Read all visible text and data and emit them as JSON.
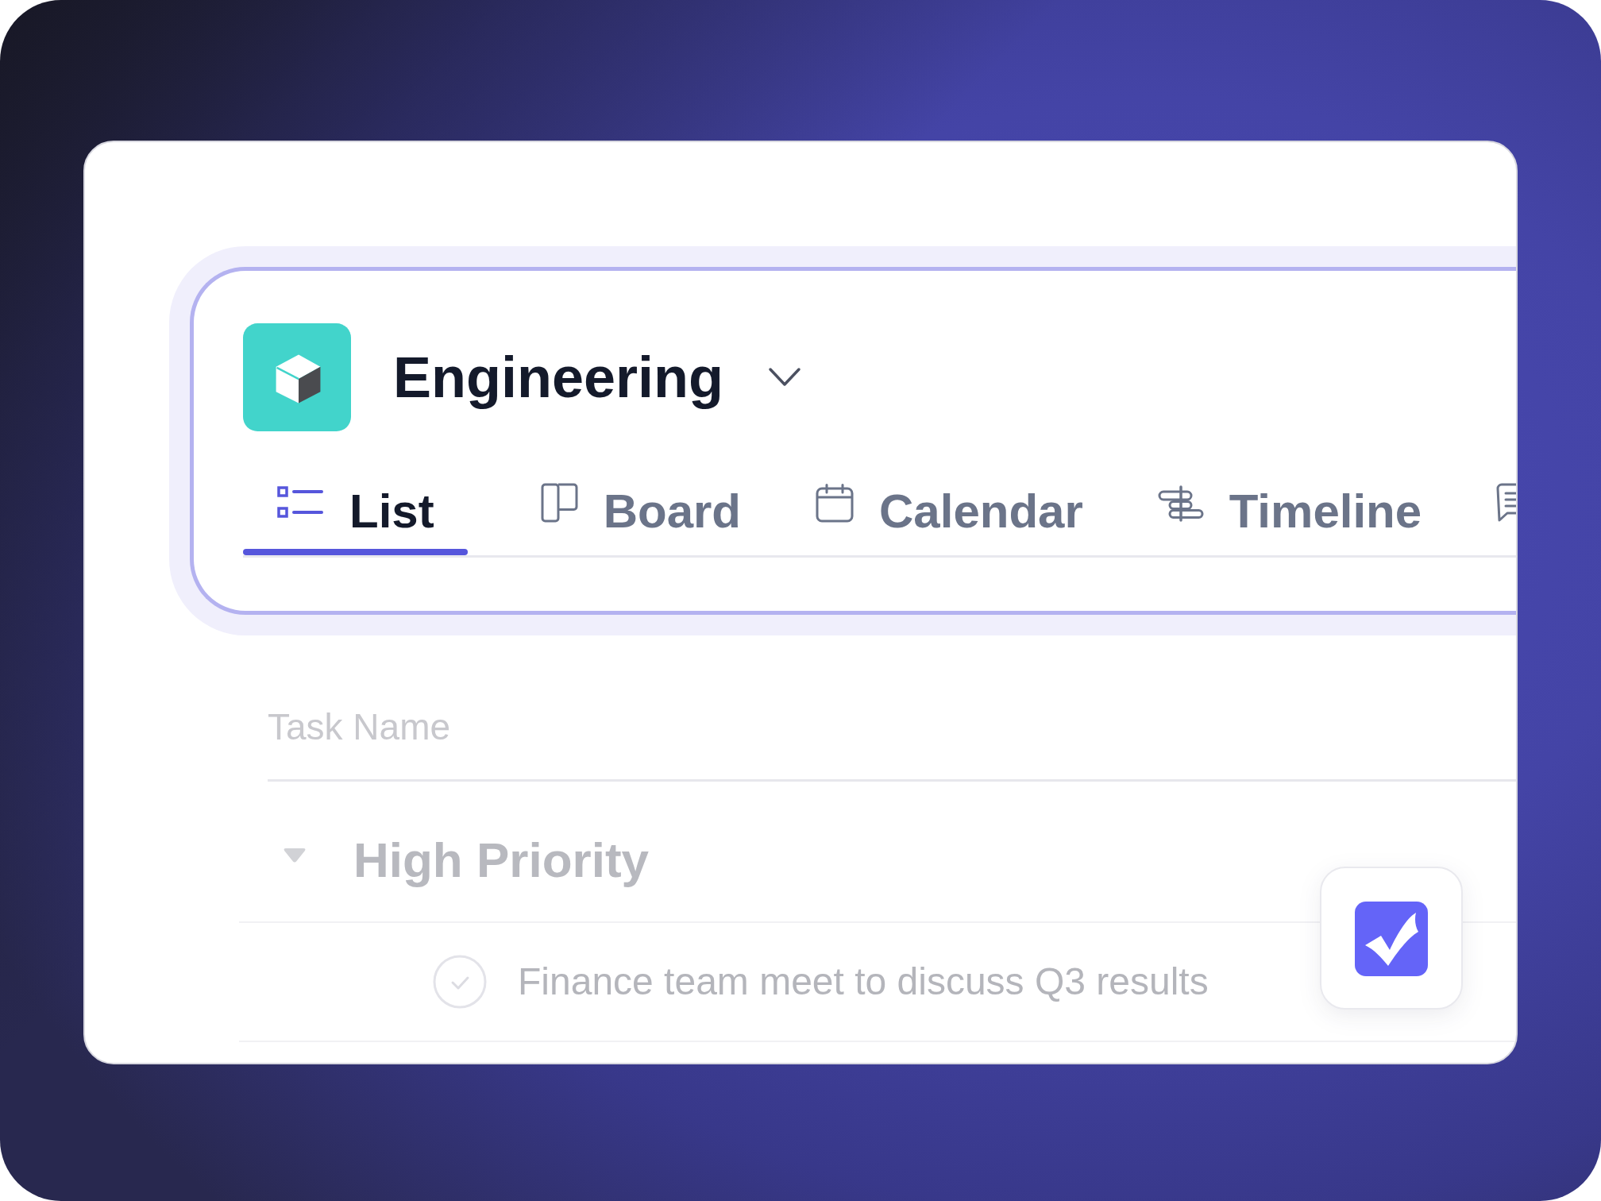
{
  "project": {
    "name": "Engineering"
  },
  "tabs": [
    {
      "label": "List",
      "selected": true
    },
    {
      "label": "Board",
      "selected": false
    },
    {
      "label": "Calendar",
      "selected": false
    },
    {
      "label": "Timeline",
      "selected": false
    },
    {
      "selected": false
    }
  ],
  "table": {
    "columns": [
      "Task Name"
    ],
    "groups": [
      {
        "title": "High Priority",
        "expanded": true,
        "tasks": [
          {
            "name": "Finance team meet to discuss Q3 results",
            "completed": false
          }
        ]
      }
    ]
  }
}
